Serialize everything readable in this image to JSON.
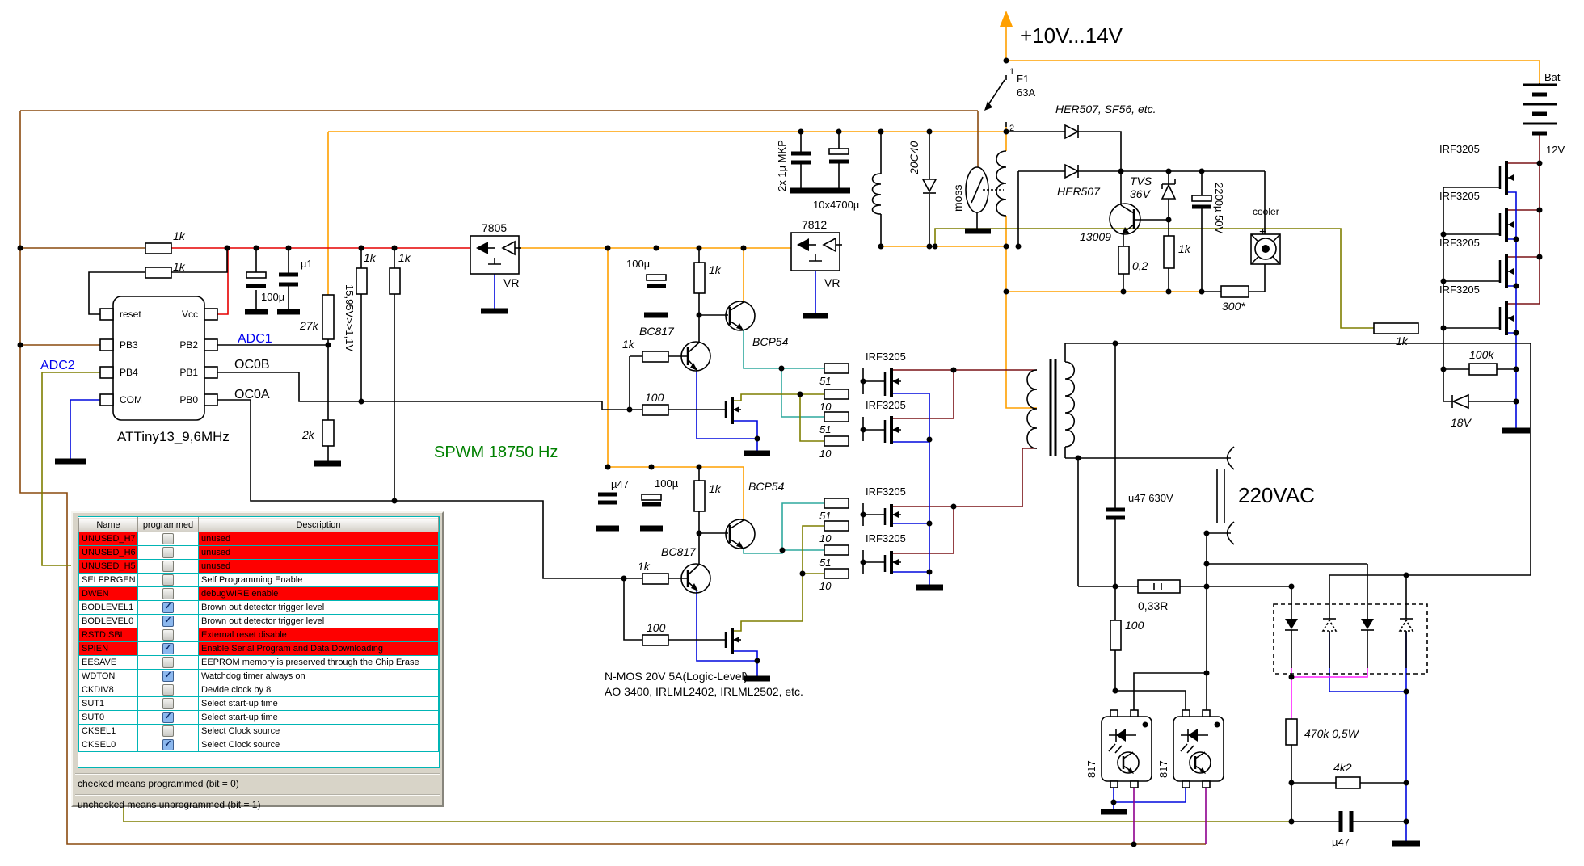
{
  "power": {
    "vin": "+10V...14V",
    "fuse": "F1",
    "fuse_rating": "63A",
    "pin1": "1",
    "pin2": "2",
    "bat": "Bat",
    "bat_v": "12V"
  },
  "regs": {
    "v7805": "7805",
    "v7812": "7812",
    "vr": "VR"
  },
  "mcu": {
    "name": "ATTiny13_9,6MHz",
    "reset": "reset",
    "vcc": "Vcc",
    "pb3": "PB3",
    "pb2": "PB2",
    "pb4": "PB4",
    "pb1": "PB1",
    "com": "COM",
    "pb0": "PB0",
    "adc1": "ADC1",
    "adc2": "ADC2",
    "oc0b": "OC0B",
    "oc0a": "OC0A"
  },
  "caps": {
    "c100u": "100µ",
    "cu1": "µ1",
    "cmkp": "2x 1µ MKP",
    "c4700": "10x4700µ",
    "c2200": "2200µ 50V",
    "cu47": "µ47",
    "cu47hv": "u47 630V"
  },
  "res": {
    "r1k": "1k",
    "r2k": "2k",
    "r27k": "27k",
    "r51": "51",
    "r10": "10",
    "r100": "100",
    "r100k": "100k",
    "r033": "0,33R",
    "r470k": "470k 0,5W",
    "r4k2": "4k2",
    "r300": "300*",
    "r02": "0,2",
    "divider": "15,95V>>1,1V"
  },
  "semis": {
    "bc817": "BC817",
    "bcp54": "BCP54",
    "irf": "IRF3205",
    "t13009": "13009",
    "her_list": "HER507, SF56, etc.",
    "her": "HER507",
    "tvs": "TVS",
    "tvs_v": "36V",
    "d20c40": "20C40",
    "opto": "817",
    "z18": "18V"
  },
  "misc": {
    "spwm": "SPWM 18750 Hz",
    "vac": "220VAC",
    "cooler": "cooler",
    "plus": "+",
    "moss": "moss",
    "nmos_note1": "N-MOS  20V 5A(Logic-Level)",
    "nmos_note2": "AO 3400, IRLML2402, IRLML2502, etc."
  },
  "fuse_table": {
    "headers": [
      "Name",
      "programmed",
      "Description"
    ],
    "rows": [
      {
        "name": "UNUSED_H7",
        "checked": false,
        "desc": "unused",
        "red": true
      },
      {
        "name": "UNUSED_H6",
        "checked": false,
        "desc": "unused",
        "red": true
      },
      {
        "name": "UNUSED_H5",
        "checked": false,
        "desc": "unused",
        "red": true
      },
      {
        "name": "SELFPRGEN",
        "checked": false,
        "desc": "Self Programming Enable",
        "red": false
      },
      {
        "name": "DWEN",
        "checked": false,
        "desc": "debugWIRE enable",
        "red": true
      },
      {
        "name": "BODLEVEL1",
        "checked": true,
        "desc": "Brown out detector trigger level",
        "red": false
      },
      {
        "name": "BODLEVEL0",
        "checked": true,
        "desc": "Brown out detector trigger level",
        "red": false
      },
      {
        "name": "RSTDISBL",
        "checked": false,
        "desc": "External reset disable",
        "red": true
      },
      {
        "name": "SPIEN",
        "checked": true,
        "desc": "Enable Serial Program and Data Downloading",
        "red": true
      },
      {
        "name": "EESAVE",
        "checked": false,
        "desc": "EEPROM memory is preserved through the Chip Erase",
        "red": false
      },
      {
        "name": "WDTON",
        "checked": true,
        "desc": "Watchdog timer always on",
        "red": false
      },
      {
        "name": "CKDIV8",
        "checked": false,
        "desc": "Devide clock by 8",
        "red": false
      },
      {
        "name": "SUT1",
        "checked": false,
        "desc": "Select start-up time",
        "red": false
      },
      {
        "name": "SUT0",
        "checked": true,
        "desc": "Select start-up time",
        "red": false
      },
      {
        "name": "CKSEL1",
        "checked": false,
        "desc": "Select Clock source",
        "red": false
      },
      {
        "name": "CKSEL0",
        "checked": true,
        "desc": "Select Clock source",
        "red": false
      }
    ],
    "note1": "checked means programmed (bit = 0)",
    "note2": "unchecked means unprogrammed (bit = 1)"
  }
}
